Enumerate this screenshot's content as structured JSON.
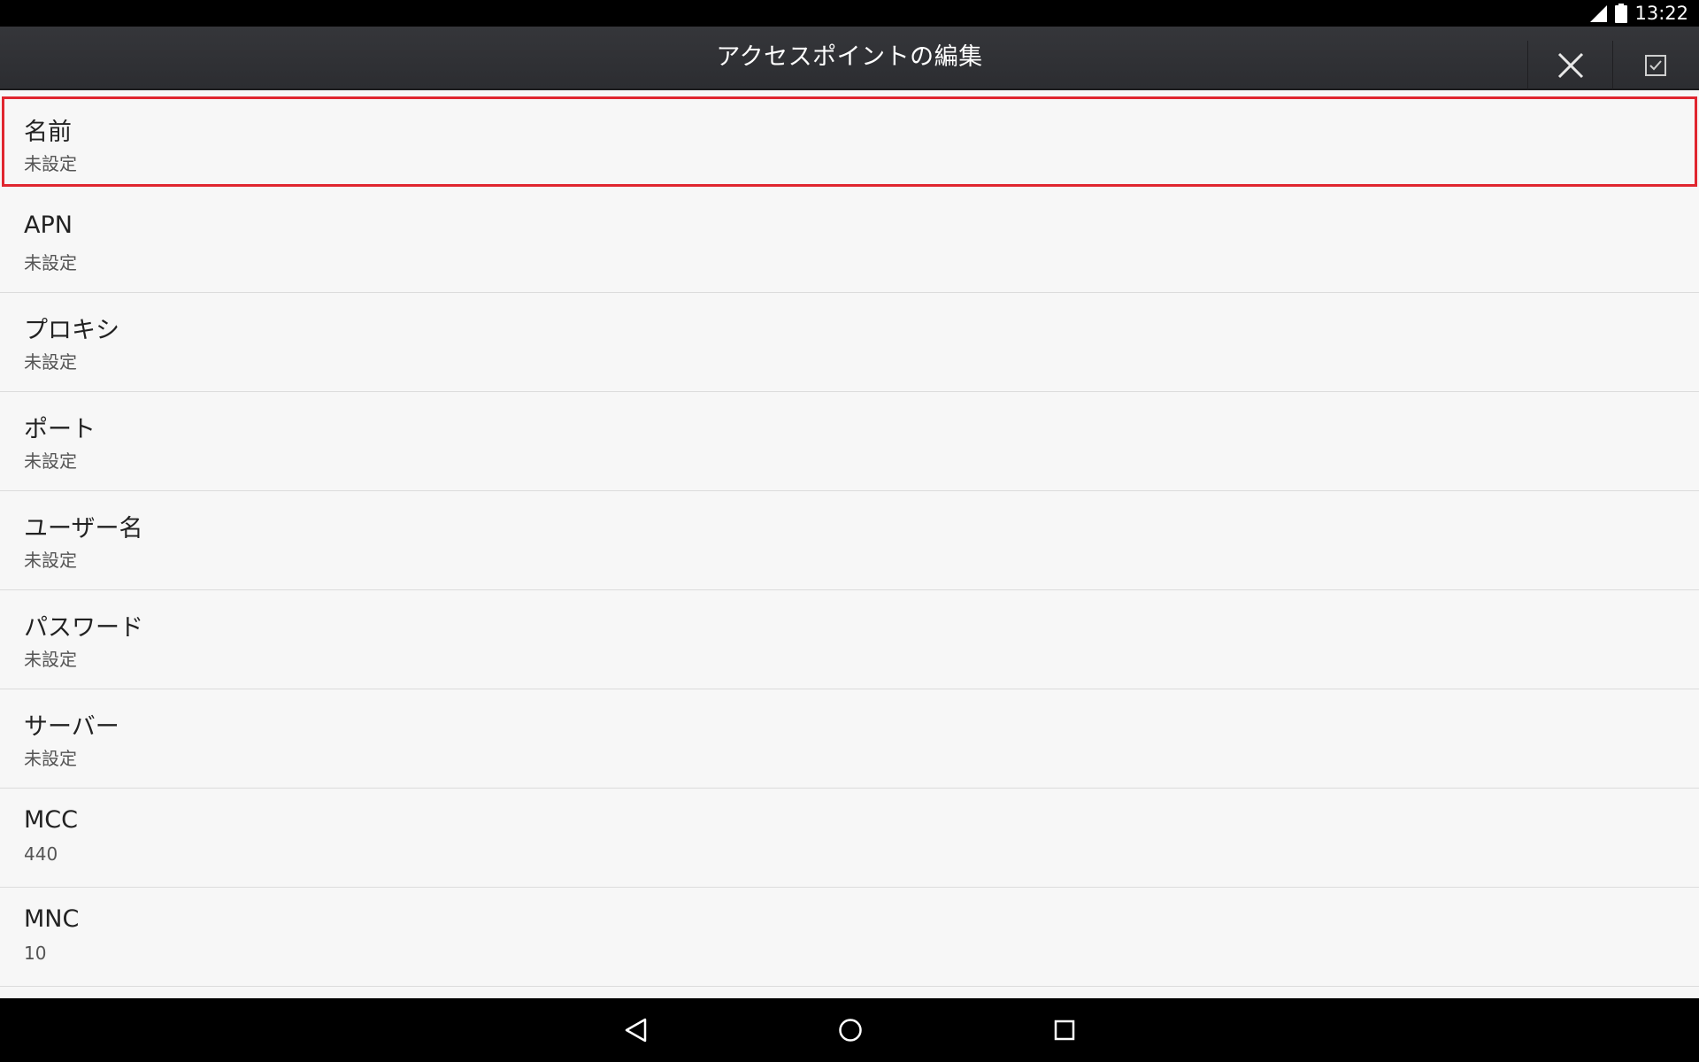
{
  "status_bar": {
    "time": "13:22",
    "icons": [
      "signal-icon",
      "battery-icon"
    ]
  },
  "action_bar": {
    "title": "アクセスポイントの編集",
    "close_icon": "close-icon",
    "save_icon": "checkbox-check-icon"
  },
  "list": {
    "items": [
      {
        "title": "名前",
        "value": "未設定",
        "selected": true
      },
      {
        "title": "APN",
        "value": "未設定"
      },
      {
        "title": "プロキシ",
        "value": "未設定"
      },
      {
        "title": "ポート",
        "value": "未設定"
      },
      {
        "title": "ユーザー名",
        "value": "未設定"
      },
      {
        "title": "パスワード",
        "value": "未設定"
      },
      {
        "title": "サーバー",
        "value": "未設定"
      },
      {
        "title": "MCC",
        "value": "440"
      },
      {
        "title": "MNC",
        "value": "10"
      }
    ]
  },
  "nav_bar": {
    "icons": [
      "back-icon",
      "home-icon",
      "recents-icon"
    ]
  },
  "colors": {
    "highlight": "#e0262f",
    "action_bar": "#333438",
    "background": "#f7f7f7"
  }
}
